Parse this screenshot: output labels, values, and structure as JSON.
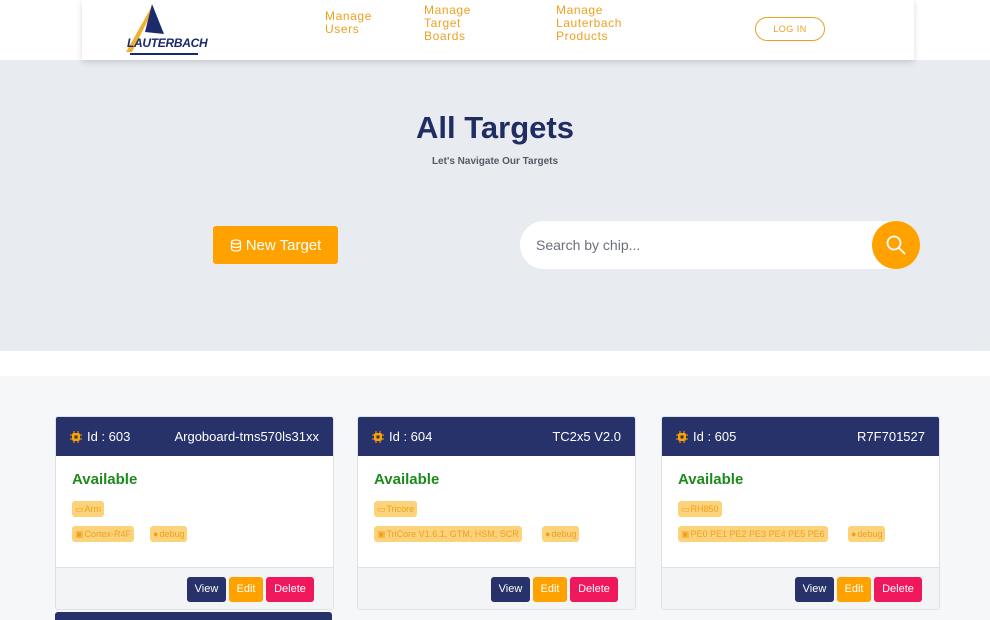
{
  "header": {
    "logo_text": "LAUTERBACH",
    "nav": [
      {
        "label": "Manage\nUsers"
      },
      {
        "label": "Manage\nTarget\nBoards"
      },
      {
        "label": "Manage\nLauterbach\nProducts"
      }
    ],
    "login_label": "LOG IN"
  },
  "hero": {
    "title": "All Targets",
    "subtitle": "Let's Navigate Our Targets",
    "new_target_label": "New Target",
    "search_placeholder": "Search by chip..."
  },
  "cards": [
    {
      "id_label": "Id : 603",
      "name": "Argoboard-tms570ls31xx",
      "status": "Available",
      "arch": "Arm",
      "core": "Cortex-R4F",
      "mode": "debug",
      "actions": {
        "view": "View",
        "edit": "Edit",
        "delete": "Delete"
      }
    },
    {
      "id_label": "Id : 604",
      "name": "TC2x5 V2.0",
      "status": "Available",
      "arch": "Tricore",
      "core": "TriCore V1.6.1, GTM, HSM, SCR",
      "mode": "debug",
      "actions": {
        "view": "View",
        "edit": "Edit",
        "delete": "Delete"
      }
    },
    {
      "id_label": "Id : 605",
      "name": "R7F701527",
      "status": "Available",
      "arch": "RH850",
      "core": "PE0 PE1 PE2 PE3 PE4 PE5 PE6",
      "mode": "debug",
      "actions": {
        "view": "View",
        "edit": "Edit",
        "delete": "Delete"
      }
    }
  ],
  "colors": {
    "navy": "#27316a",
    "accent_orange": "#ffa200",
    "available_green": "#1e8a1e",
    "delete_pink": "#f0185c"
  },
  "icons": {
    "chip": "chip-icon",
    "search": "search-icon",
    "board": "board-icon",
    "core": "core-icon",
    "debug": "debug-icon",
    "database": "database-icon"
  }
}
